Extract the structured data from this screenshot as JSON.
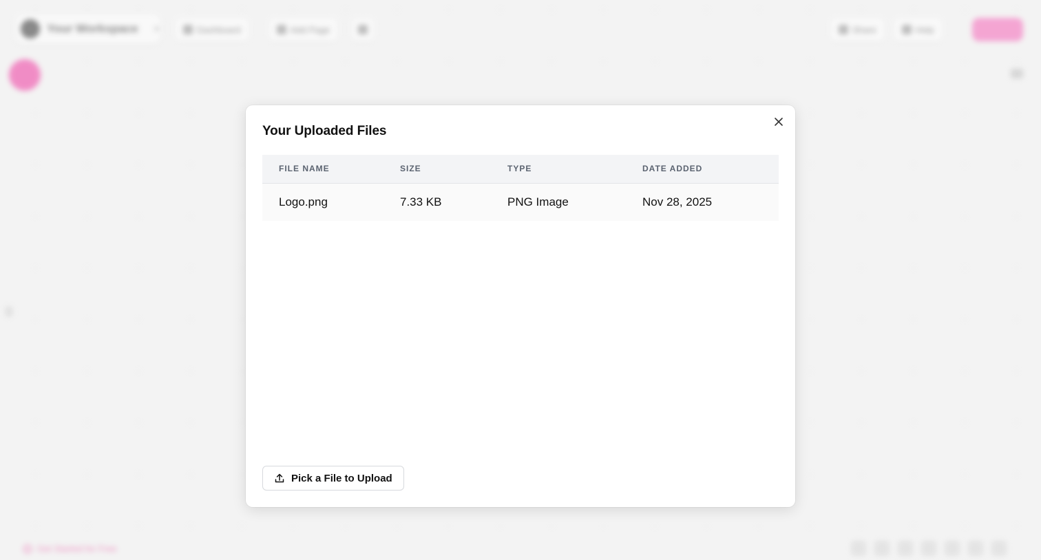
{
  "background": {
    "workspace_name": "Your Workspace",
    "toolbar_items": [
      "Dashboard",
      "Add Page",
      ""
    ],
    "right_items": [
      "Share",
      "Help"
    ],
    "share_label": "",
    "bottom_link": "Get Started for Free",
    "accent_color": "#f45ab4"
  },
  "modal": {
    "title": "Your Uploaded Files",
    "close_icon": "close-icon",
    "columns": [
      "FILE NAME",
      "SIZE",
      "TYPE",
      "DATE ADDED"
    ],
    "rows": [
      {
        "name": "Logo.png",
        "size": "7.33 KB",
        "type": "PNG Image",
        "date": "Nov 28, 2025"
      }
    ],
    "upload_button": {
      "label": "Pick a File to Upload",
      "icon": "upload-icon"
    }
  }
}
